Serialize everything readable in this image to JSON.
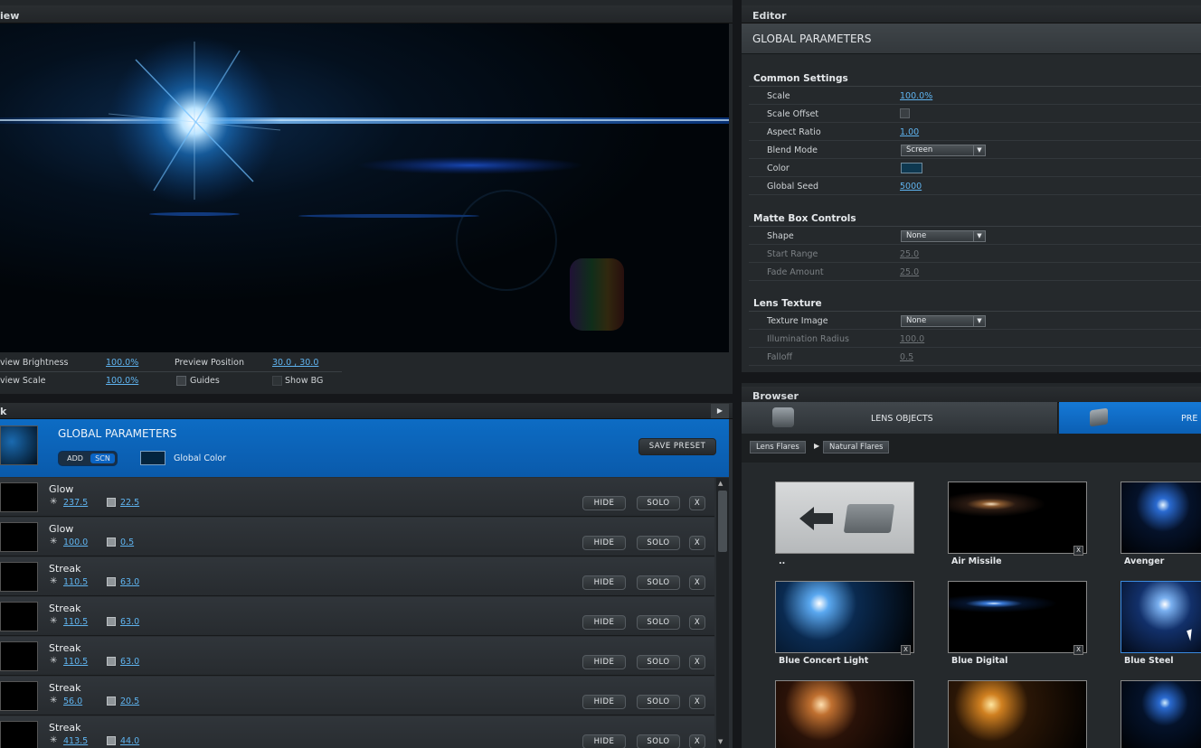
{
  "preview": {
    "title": "iew",
    "brightness_label": "view Brightness",
    "brightness_value": "100.0%",
    "scale_label": "view Scale",
    "scale_value": "100.0%",
    "position_label": "Preview Position",
    "position_value": "30.0 , 30.0",
    "guides_label": "Guides",
    "show_bg_label": "Show BG"
  },
  "stack": {
    "title": "k",
    "global": {
      "title": "GLOBAL PARAMETERS",
      "add_label": "ADD",
      "scn_label": "SCN",
      "color_label": "Global Color",
      "save_preset_label": "SAVE PRESET"
    },
    "hide_label": "HIDE",
    "solo_label": "SOLO",
    "x_label": "X",
    "layers": [
      {
        "name": "Glow",
        "v1": "237.5",
        "v2": "22.5"
      },
      {
        "name": "Glow",
        "v1": "100.0",
        "v2": "0.5"
      },
      {
        "name": "Streak",
        "v1": "110.5",
        "v2": "63.0"
      },
      {
        "name": "Streak",
        "v1": "110.5",
        "v2": "63.0"
      },
      {
        "name": "Streak",
        "v1": "110.5",
        "v2": "63.0"
      },
      {
        "name": "Streak",
        "v1": "56.0",
        "v2": "20.5"
      },
      {
        "name": "Streak",
        "v1": "413.5",
        "v2": "44.0"
      }
    ]
  },
  "editor": {
    "title": "Editor",
    "header": "GLOBAL PARAMETERS",
    "common": {
      "title": "Common Settings",
      "scale_label": "Scale",
      "scale_value": "100.0%",
      "scale_offset_label": "Scale Offset",
      "aspect_label": "Aspect Ratio",
      "aspect_value": "1.00",
      "blend_label": "Blend Mode",
      "blend_value": "Screen",
      "color_label": "Color",
      "seed_label": "Global Seed",
      "seed_value": "5000"
    },
    "matte": {
      "title": "Matte Box Controls",
      "shape_label": "Shape",
      "shape_value": "None",
      "start_label": "Start Range",
      "start_value": "25.0",
      "fade_label": "Fade Amount",
      "fade_value": "25.0"
    },
    "texture": {
      "title": "Lens Texture",
      "image_label": "Texture Image",
      "image_value": "None",
      "radius_label": "Illumination Radius",
      "radius_value": "100.0",
      "falloff_label": "Falloff",
      "falloff_value": "0.5"
    }
  },
  "browser": {
    "title": "Browser",
    "tab_lens_objects": "LENS OBJECTS",
    "tab_presets": "PRE",
    "crumb_1": "Lens Flares",
    "crumb_2": "Natural Flares",
    "presets": [
      {
        "name": ".."
      },
      {
        "name": "Air Missile"
      },
      {
        "name": "Avenger"
      },
      {
        "name": "Blue Concert Light"
      },
      {
        "name": "Blue Digital"
      },
      {
        "name": "Blue Steel"
      }
    ],
    "x_label": "X"
  },
  "colors": {
    "accent": "#0a63b8",
    "value_blue": "#5fb4f0",
    "panel": "#23272a"
  }
}
